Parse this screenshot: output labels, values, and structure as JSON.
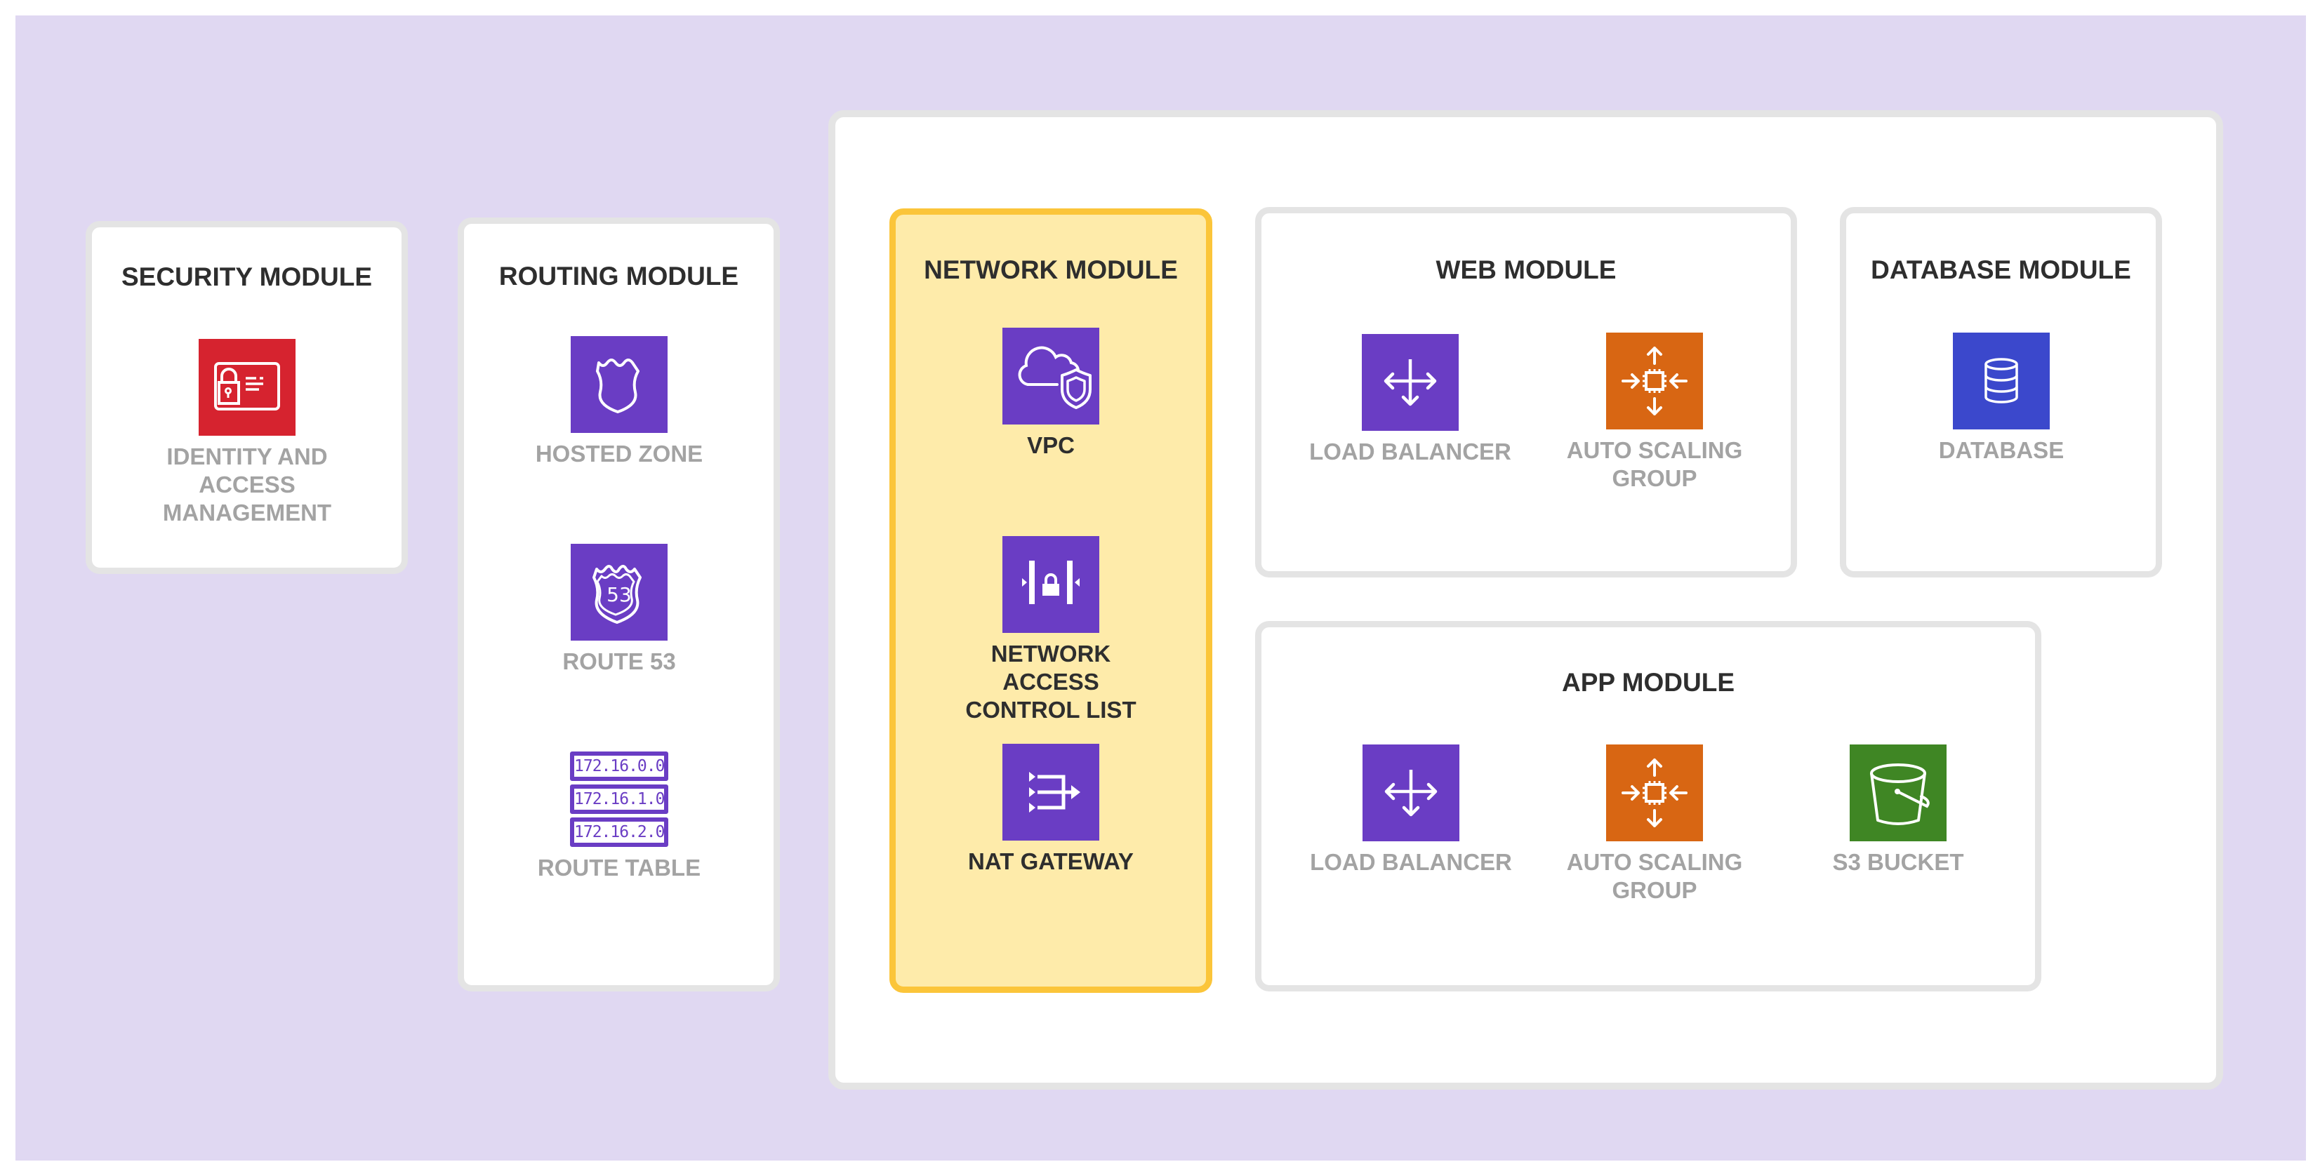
{
  "colors": {
    "background": "#e0d8f2",
    "card_border": "#e4e4e4",
    "highlight_fill": "#feebaa",
    "highlight_border": "#fbc53a",
    "security_red": "#d6232f",
    "networking_purple": "#6a3dc4",
    "compute_orange": "#d86613",
    "database_blue": "#3b48cc",
    "storage_green": "#3f8624"
  },
  "modules": {
    "security": {
      "title": "SECURITY MODULE",
      "items": [
        {
          "label_lines": [
            "IDENTITY AND",
            "ACCESS",
            "MANAGEMENT"
          ],
          "icon": "iam-lock-card-icon"
        }
      ]
    },
    "routing": {
      "title": "ROUTING MODULE",
      "items": [
        {
          "label": "HOSTED ZONE",
          "icon": "shield-badge-icon"
        },
        {
          "label": "ROUTE 53",
          "icon": "route53-shield-icon",
          "icon_text": "53"
        },
        {
          "label": "ROUTE TABLE",
          "icon": "route-table-icon",
          "routes": [
            "172.16.0.0",
            "172.16.1.0",
            "172.16.2.0"
          ]
        }
      ]
    },
    "network": {
      "title": "NETWORK MODULE",
      "highlighted": true,
      "items": [
        {
          "label": "VPC",
          "icon": "cloud-shield-icon"
        },
        {
          "label_lines": [
            "NETWORK ACCESS",
            "CONTROL LIST"
          ],
          "icon": "nacl-lock-icon"
        },
        {
          "label": "NAT GATEWAY",
          "icon": "nat-gateway-icon"
        }
      ]
    },
    "web": {
      "title": "WEB MODULE",
      "items": [
        {
          "label": "LOAD BALANCER",
          "icon": "load-balancer-icon"
        },
        {
          "label_lines": [
            "AUTO SCALING",
            "GROUP"
          ],
          "icon": "auto-scaling-icon"
        }
      ]
    },
    "database": {
      "title": "DATABASE MODULE",
      "items": [
        {
          "label": "DATABASE",
          "icon": "database-icon"
        }
      ]
    },
    "app": {
      "title": "APP MODULE",
      "items": [
        {
          "label": "LOAD BALANCER",
          "icon": "load-balancer-icon"
        },
        {
          "label_lines": [
            "AUTO SCALING",
            "GROUP"
          ],
          "icon": "auto-scaling-icon"
        },
        {
          "label": "S3 BUCKET",
          "icon": "s3-bucket-icon"
        }
      ]
    }
  }
}
